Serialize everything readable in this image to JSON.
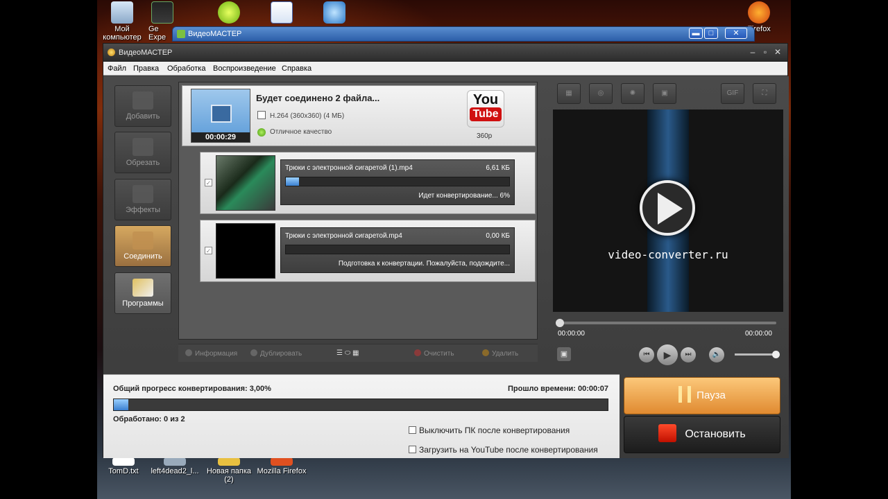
{
  "desktop": {
    "icons_top": [
      {
        "label": "Мой компьютер"
      },
      {
        "label": "Ge Expe"
      },
      {
        "label": ""
      },
      {
        "label": ""
      },
      {
        "label": ""
      },
      {
        "label": "Firefox"
      }
    ],
    "icons_bottom": [
      {
        "label": "TomD.txt"
      },
      {
        "label": "left4dead2_l..."
      },
      {
        "label": "Новая папка (2)"
      },
      {
        "label": "Mozilla Firefox"
      }
    ]
  },
  "background_window": {
    "title": "ВидеоМАСТЕР"
  },
  "app": {
    "title": "ВидеоМАСТЕР",
    "menu": [
      "Файл",
      "Правка",
      "Обработка",
      "Воспроизведение",
      "Справка"
    ],
    "left_buttons": [
      {
        "label": "Добавить"
      },
      {
        "label": "Обрезать"
      },
      {
        "label": "Эффекты"
      },
      {
        "label": "Соединить"
      },
      {
        "label": "Программы"
      }
    ],
    "summary": {
      "title": "Будет соединено 2 файла...",
      "codec": "H.264 (360x360) (4 МБ)",
      "quality": "Отличное качество",
      "duration": "00:00:29",
      "preset": "360p",
      "youtube_top": "You",
      "youtube_bottom": "Tube"
    },
    "files": [
      {
        "name": "Трюки с электронной сигаретой (1).mp4",
        "size": "6,61 КБ",
        "status": "Идет конвертирование... 6%",
        "progress": 0.06
      },
      {
        "name": "Трюки с электронной сигаретой.mp4",
        "size": "0,00 КБ",
        "status": "Подготовка к конвертации. Пожалуйста, подождите...",
        "progress": 0
      }
    ],
    "list_toolbar": {
      "info": "Информация",
      "duplicate": "Дублировать",
      "clear": "Очистить",
      "delete": "Удалить"
    },
    "preview": {
      "brand": "video-converter.ru",
      "time_current": "00:00:00",
      "time_total": "00:00:00",
      "gif_label": "GIF"
    },
    "progress": {
      "label": "Общий прогресс конвертирования: 3,00%",
      "elapsed": "Прошло времени: 00:00:07",
      "processed": "Обработано: 0 из 2",
      "value": 0.03,
      "shutdown_option": "Выключить ПК после конвертирования",
      "upload_option": "Загрузить на YouTube после конвертирования"
    },
    "pause_label": "Пауза",
    "stop_label": "Остановить"
  }
}
